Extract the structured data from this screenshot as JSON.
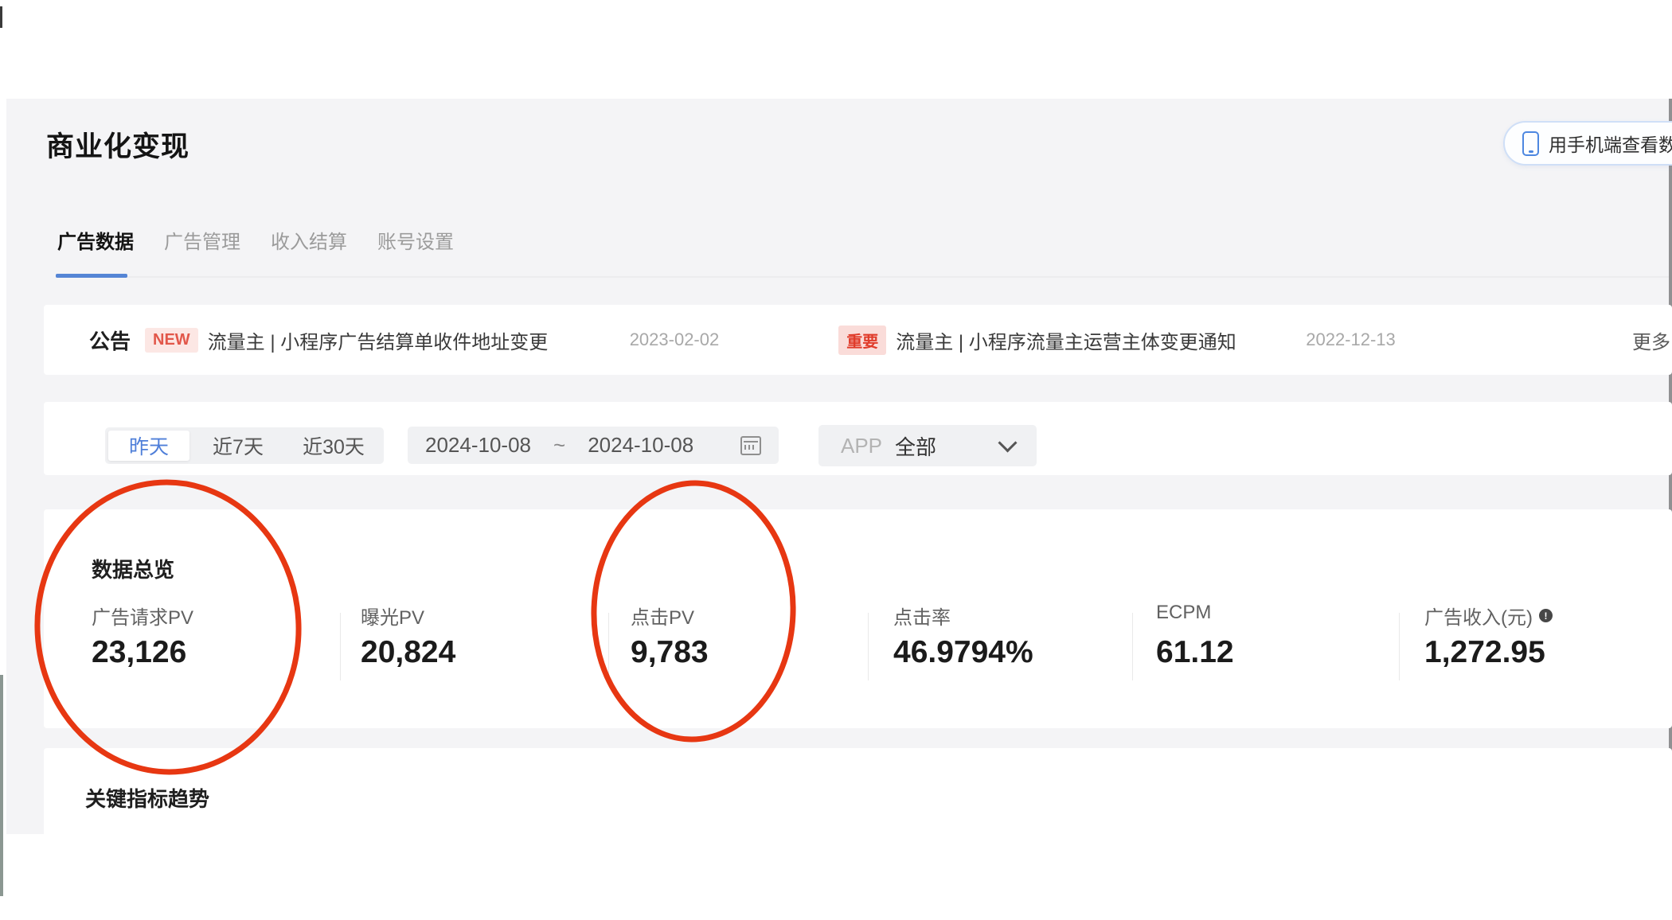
{
  "header": {
    "title": "商业化变现",
    "phone_button_label": "用手机端查看数据"
  },
  "tabs": [
    {
      "label": "广告数据",
      "active": true
    },
    {
      "label": "广告管理",
      "active": false
    },
    {
      "label": "收入结算",
      "active": false
    },
    {
      "label": "账号设置",
      "active": false
    }
  ],
  "announcement": {
    "label": "公告",
    "more_label": "更多",
    "items": [
      {
        "badge": "NEW",
        "title": "流量主 | 小程序广告结算单收件地址变更",
        "date": "2023-02-02"
      },
      {
        "badge": "重要",
        "title": "流量主 | 小程序流量主运营主体变更通知",
        "date": "2022-12-13"
      }
    ]
  },
  "filter_bar": {
    "quick_ranges": [
      {
        "label": "昨天",
        "selected": true
      },
      {
        "label": "近7天",
        "selected": false
      },
      {
        "label": "近30天",
        "selected": false
      }
    ],
    "date_range": {
      "start": "2024-10-08",
      "separator": "~",
      "end": "2024-10-08"
    },
    "app_filter": {
      "label": "APP",
      "value": "全部"
    }
  },
  "overview": {
    "section_title": "数据总览",
    "metrics": [
      {
        "label": "广告请求PV",
        "value": "23,126",
        "circled": true
      },
      {
        "label": "曝光PV",
        "value": "20,824",
        "circled": false
      },
      {
        "label": "点击PV",
        "value": "9,783",
        "circled": true
      },
      {
        "label": "点击率",
        "value": "46.9794%",
        "circled": false
      },
      {
        "label": "ECPM",
        "value": "61.12",
        "circled": false
      },
      {
        "label": "广告收入(元)",
        "value": "1,272.95",
        "circled": false,
        "has_info_icon": true
      }
    ]
  },
  "trend": {
    "section_title": "关键指标趋势"
  },
  "annotations": {
    "description": "hand-drawn red ellipses circling the 广告请求PV and 点击PV metrics",
    "color": "#e73712"
  },
  "colors": {
    "accent_blue": "#5585d5",
    "badge_red": "#e0402c",
    "page_bg": "#f4f4f6",
    "card_bg": "#ffffff"
  }
}
